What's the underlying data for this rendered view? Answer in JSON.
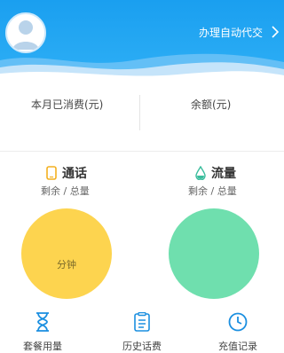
{
  "header": {
    "auto_pay_label": "办理自动代交"
  },
  "stats": {
    "spent_label": "本月已消费(元)",
    "balance_label": "余额(元)"
  },
  "calls": {
    "title": "通话",
    "subtitle": "剩余 / 总量",
    "unit_label": "分钟",
    "color": "#fdd44f"
  },
  "data": {
    "title": "流量",
    "subtitle": "剩余 / 总量",
    "color": "#6fdfae"
  },
  "bottom_nav": [
    {
      "label": "套餐用量",
      "icon": "hourglass-icon"
    },
    {
      "label": "历史话费",
      "icon": "bill-icon"
    },
    {
      "label": "充值记录",
      "icon": "clock-icon"
    }
  ],
  "colors": {
    "header_blue": "#1ea4f2",
    "icon_blue": "#1b8fe0",
    "phone_orange": "#f3b020",
    "drop_teal": "#3bbd9d"
  }
}
